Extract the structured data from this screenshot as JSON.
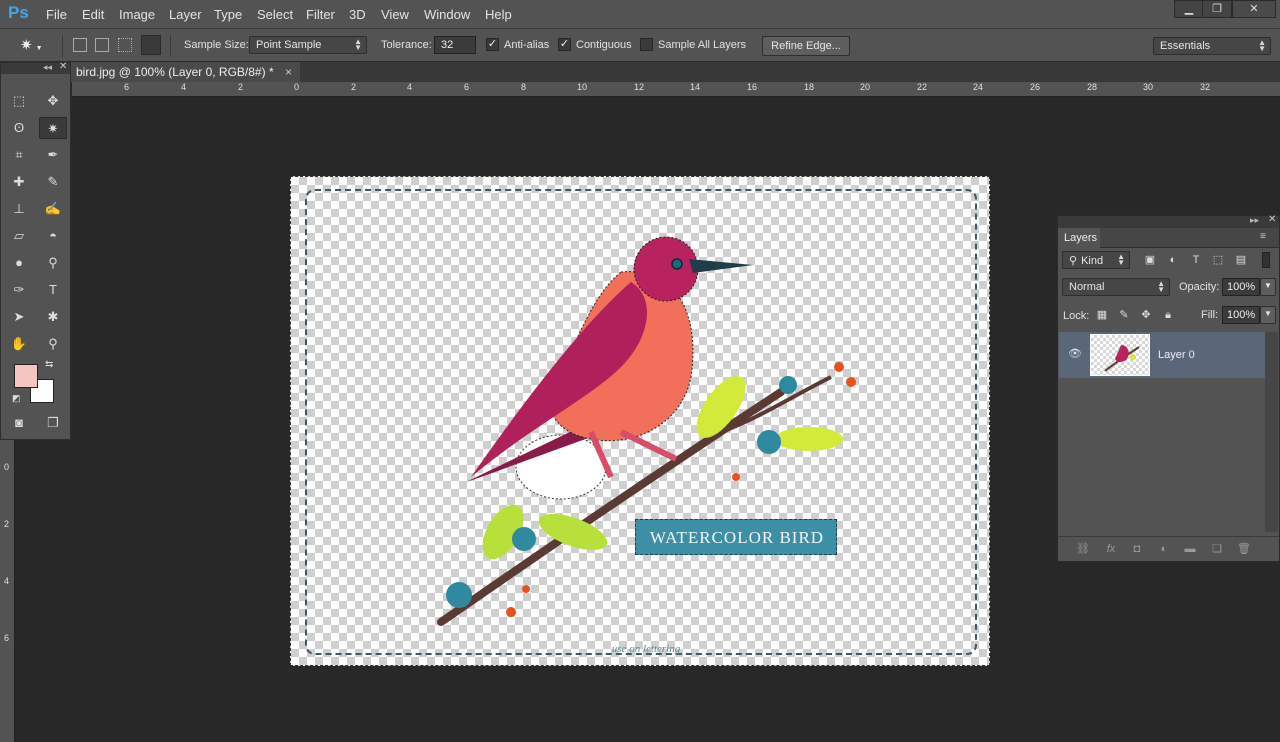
{
  "app": {
    "logo": "Ps"
  },
  "menu": [
    "File",
    "Edit",
    "Image",
    "Layer",
    "Type",
    "Select",
    "Filter",
    "3D",
    "View",
    "Window",
    "Help"
  ],
  "window_controls": {
    "minimize": "▁",
    "restore": "❐",
    "close": "✕"
  },
  "options": {
    "sample_size_label": "Sample Size:",
    "sample_size_value": "Point Sample",
    "tolerance_label": "Tolerance:",
    "tolerance_value": "32",
    "anti_alias_label": "Anti-alias",
    "anti_alias_checked": true,
    "contiguous_label": "Contiguous",
    "contiguous_checked": true,
    "sample_all_layers_label": "Sample All Layers",
    "sample_all_layers_checked": false,
    "refine_edge_label": "Refine Edge...",
    "workspace": "Essentials"
  },
  "document": {
    "tab_title": "bird.jpg @ 100% (Layer 0, RGB/8#) *",
    "close": "×"
  },
  "ruler_h": [
    "6",
    "4",
    "2",
    "0",
    "2",
    "4",
    "6",
    "8",
    "10",
    "12",
    "14",
    "16",
    "18",
    "20",
    "22",
    "24",
    "26",
    "28",
    "30",
    "32"
  ],
  "ruler_v": [
    "0",
    "2",
    "4",
    "6"
  ],
  "artwork": {
    "banner_text": "WATERCOLOR BIRD",
    "footer_script": "use on lettering"
  },
  "colors": {
    "foreground": "#f5c5c2",
    "background": "#ffffff",
    "selection_tint": "#596778"
  },
  "layers_panel": {
    "tab": "Layers",
    "filter_kind": "Kind",
    "blend_mode": "Normal",
    "opacity_label": "Opacity:",
    "opacity_value": "100%",
    "lock_label": "Lock:",
    "fill_label": "Fill:",
    "fill_value": "100%",
    "layers": [
      {
        "name": "Layer 0",
        "visible": true,
        "selected": true
      }
    ]
  }
}
